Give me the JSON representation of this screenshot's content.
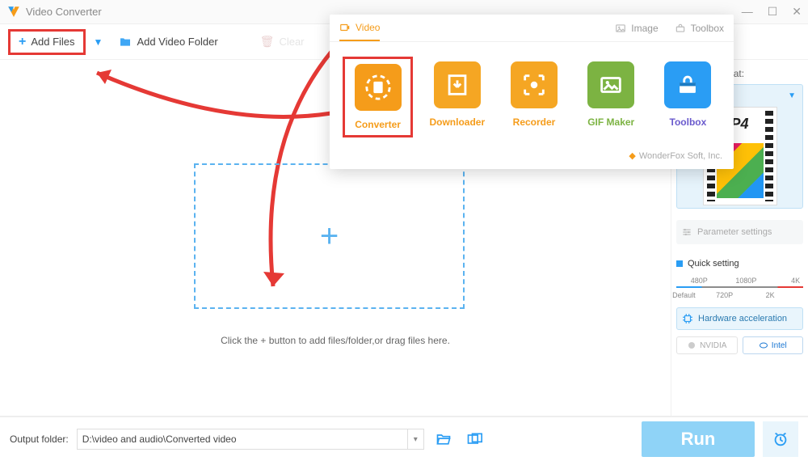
{
  "title": "Video Converter",
  "toolbar": {
    "add_files": "Add Files",
    "add_folder": "Add Video Folder",
    "clear": "Clear"
  },
  "dropzone_hint": "Click the + button to add files/folder,or drag files here.",
  "right": {
    "label": "e output format:",
    "format_short": "P4",
    "thumb_label": "P4",
    "param": "Parameter settings",
    "quick_setting": "Quick setting",
    "ticks_top": [
      "480P",
      "1080P",
      "4K"
    ],
    "ticks_bottom": [
      "Default",
      "720P",
      "2K"
    ],
    "hw": "Hardware acceleration",
    "nvidia": "NVIDIA",
    "intel": "Intel"
  },
  "popup": {
    "tabs": {
      "video": "Video",
      "image": "Image",
      "toolbox": "Toolbox"
    },
    "tools": {
      "converter": "Converter",
      "downloader": "Downloader",
      "recorder": "Recorder",
      "gifmaker": "GIF Maker",
      "toolbox": "Toolbox"
    },
    "footer": "WonderFox Soft, Inc."
  },
  "bottom": {
    "label": "Output folder:",
    "path": "D:\\video and audio\\Converted video",
    "run": "Run"
  }
}
